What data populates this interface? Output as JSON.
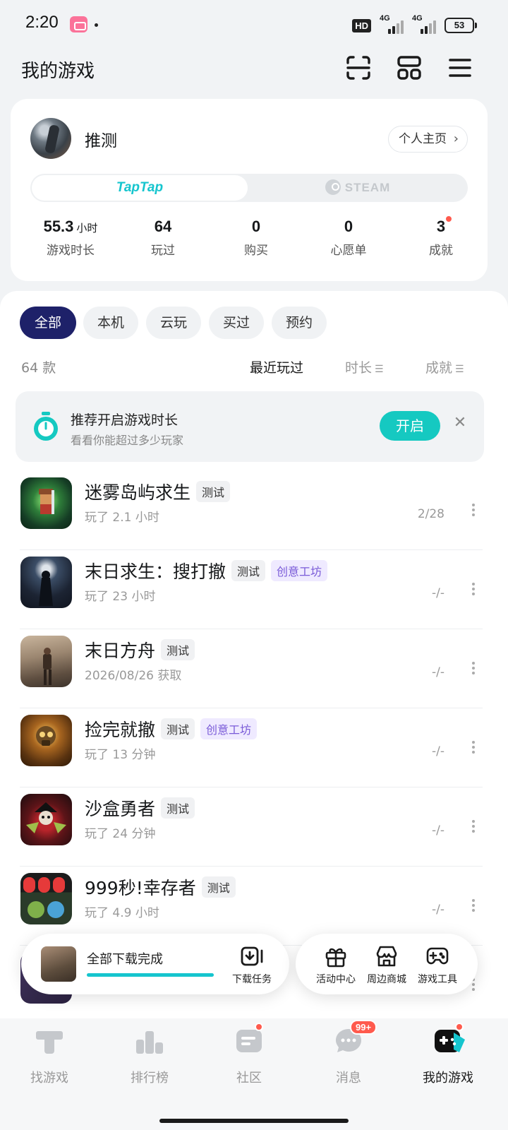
{
  "status_bar": {
    "time": "2:20",
    "hd_label": "HD",
    "net1": "4G",
    "net2": "4G",
    "battery": "53"
  },
  "header": {
    "title": "我的游戏"
  },
  "profile": {
    "username": "推测",
    "homepage_label": "个人主页",
    "platforms": {
      "taptap": "TapTap",
      "steam": "STEAM"
    },
    "stats": [
      {
        "value": "55.3",
        "unit": "小时",
        "label": "游戏时长"
      },
      {
        "value": "64",
        "label": "玩过"
      },
      {
        "value": "0",
        "label": "购买"
      },
      {
        "value": "0",
        "label": "心愿单"
      },
      {
        "value": "3",
        "label": "成就"
      }
    ]
  },
  "filters": [
    "全部",
    "本机",
    "云玩",
    "买过",
    "预约"
  ],
  "list_header": {
    "count": "64 款",
    "sort_recent": "最近玩过",
    "sort_duration": "时长",
    "sort_achievement": "成就"
  },
  "banner": {
    "title": "推荐开启游戏时长",
    "subtitle": "看看你能超过多少玩家",
    "button": "开启"
  },
  "games": [
    {
      "name": "迷雾岛屿求生",
      "tags": [
        "测试"
      ],
      "sub": "玩了 2.1 小时",
      "progress": "2/28"
    },
    {
      "name": "末日求生：搜打撤",
      "tags": [
        "测试",
        "创意工坊"
      ],
      "sub": "玩了 23 小时",
      "progress": "-/-"
    },
    {
      "name": "末日方舟",
      "tags": [
        "测试"
      ],
      "sub": "2026/08/26 获取",
      "progress": "-/-"
    },
    {
      "name": "捡完就撤",
      "tags": [
        "测试",
        "创意工坊"
      ],
      "sub": "玩了 13 分钟",
      "progress": "-/-"
    },
    {
      "name": "沙盒勇者",
      "tags": [
        "测试"
      ],
      "sub": "玩了 24 分钟",
      "progress": "-/-"
    },
    {
      "name": "999秒!幸存者",
      "tags": [
        "测试"
      ],
      "sub": "玩了 4.9 小时",
      "progress": "-/-"
    }
  ],
  "download": {
    "status": "全部下载完成",
    "progress": 1.0,
    "task_label": "下载任务"
  },
  "tools": [
    "活动中心",
    "周边商城",
    "游戏工具"
  ],
  "bottom_nav": [
    {
      "label": "找游戏"
    },
    {
      "label": "排行榜"
    },
    {
      "label": "社区"
    },
    {
      "label": "消息",
      "badge": "99+"
    },
    {
      "label": "我的游戏"
    }
  ],
  "colors": {
    "accent": "#15c5ce",
    "active_chip": "#1e2169",
    "badge_red": "#ff5a4d",
    "workshop_purple": "#7a5bd8"
  }
}
